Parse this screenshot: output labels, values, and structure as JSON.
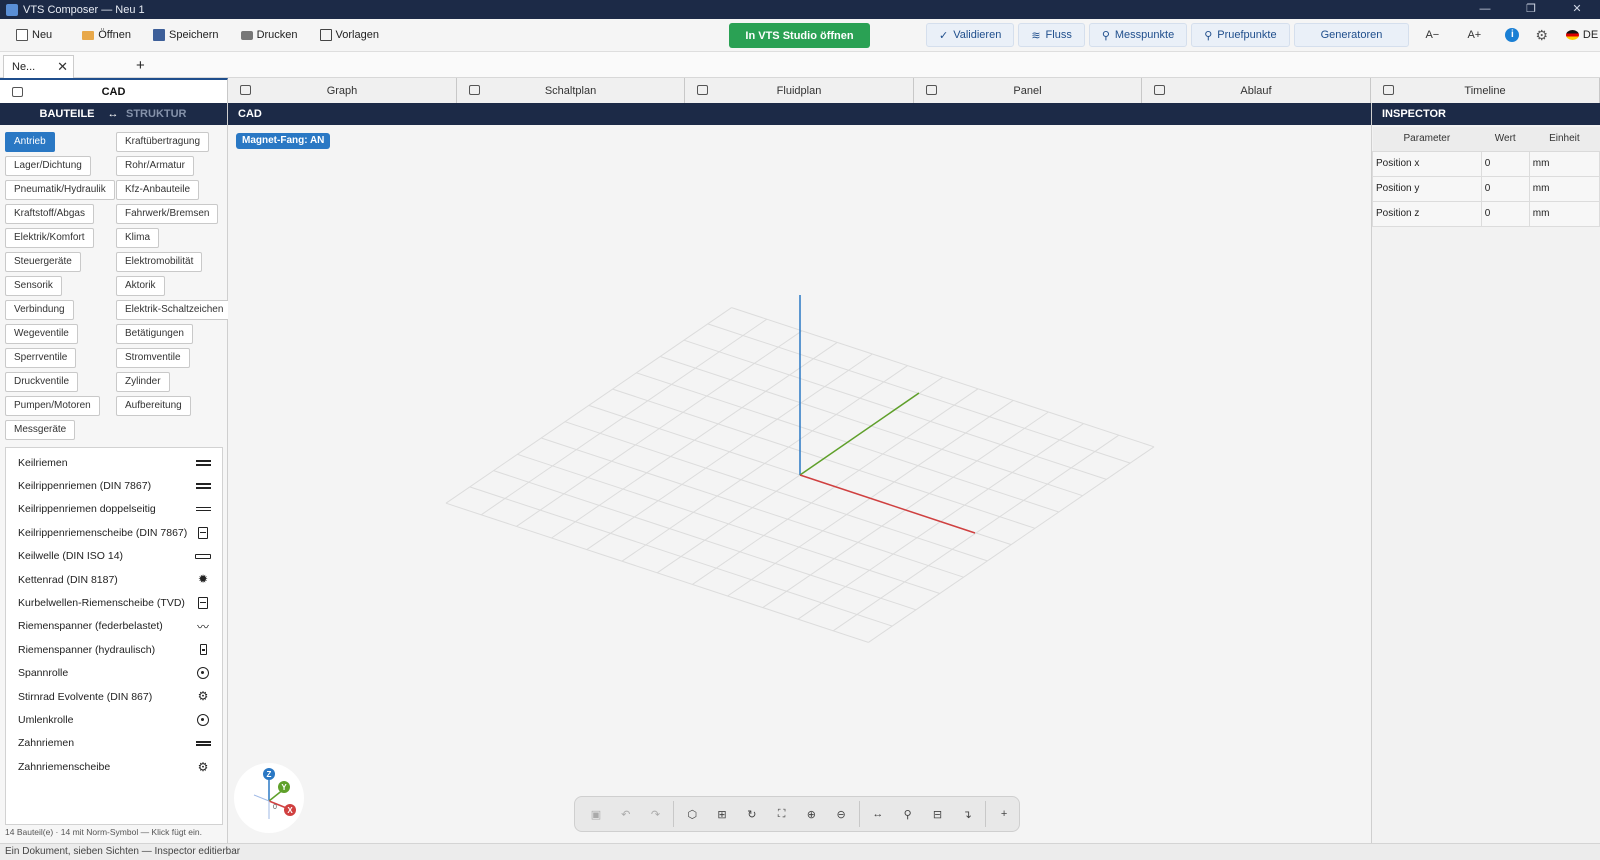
{
  "window": {
    "title": "VTS Composer — Neu 1",
    "controls": [
      "—",
      "❐",
      "✕"
    ]
  },
  "toolbar": {
    "new_label": "Neu",
    "open_label": "Öffnen",
    "save_label": "Speichern",
    "print_label": "Drucken",
    "templates_label": "Vorlagen",
    "studio_label": "In VTS Studio öffnen",
    "validate_label": "Validieren",
    "flow_label": "Fluss",
    "measure_points_label": "Messpunkte",
    "test_points_label": "Pruefpunkte",
    "generators_label": "Generatoren",
    "font_smaller": "A−",
    "font_larger": "A+",
    "language": "DE"
  },
  "doc_tabs": {
    "active_label": "Ne...",
    "close_glyph": "✕",
    "add_glyph": "+"
  },
  "view_tabs": [
    "CAD",
    "Graph",
    "Schaltplan",
    "Fluidplan",
    "Panel",
    "Ablauf",
    "Timeline"
  ],
  "left": {
    "tab_components": "BAUTEILE",
    "swap_glyph": "↔",
    "tab_structure": "STRUKTUR",
    "categories": [
      "Antrieb",
      "Kraftübertragung",
      "Lager/Dichtung",
      "Rohr/Armatur",
      "Pneumatik/Hydraulik",
      "Kfz-Anbauteile",
      "Kraftstoff/Abgas",
      "Fahrwerk/Bremsen",
      "Elektrik/Komfort",
      "Klima",
      "Steuergeräte",
      "Elektromobilität",
      "Sensorik",
      "Aktorik",
      "Verbindung",
      "Elektrik-Schaltzeichen",
      "Wegeventile",
      "Betätigungen",
      "Sperrventile",
      "Stromventile",
      "Druckventile",
      "Zylinder",
      "Pumpen/Motoren",
      "Aufbereitung",
      "Messgeräte"
    ],
    "components": [
      {
        "label": "Keilriemen",
        "icon": "double-line-icon"
      },
      {
        "label": "Keilrippenriemen (DIN 7867)",
        "icon": "double-line-icon"
      },
      {
        "label": "Keilrippenriemen doppelseitig",
        "icon": "double-line-icon"
      },
      {
        "label": "Keilrippenriemenscheibe (DIN 7867)",
        "icon": "pulley-box-icon"
      },
      {
        "label": "Keilwelle (DIN ISO 14)",
        "icon": "shaft-icon"
      },
      {
        "label": "Kettenrad (DIN 8187)",
        "icon": "sprocket-icon"
      },
      {
        "label": "Kurbelwellen-Riemenscheibe (TVD)",
        "icon": "pulley-box-icon"
      },
      {
        "label": "Riemenspanner (federbelastet)",
        "icon": "spring-icon"
      },
      {
        "label": "Riemenspanner (hydraulisch)",
        "icon": "hydraulic-icon"
      },
      {
        "label": "Spannrolle",
        "icon": "roller-icon"
      },
      {
        "label": "Stirnrad Evolvente (DIN 867)",
        "icon": "gear-icon"
      },
      {
        "label": "Umlenkrolle",
        "icon": "roller-icon"
      },
      {
        "label": "Zahnriemen",
        "icon": "belt-icon"
      },
      {
        "label": "Zahnriemenscheibe",
        "icon": "gear-icon"
      }
    ],
    "footer": "14 Bauteil(e) · 14 mit Norm-Symbol — Klick fügt ein."
  },
  "center": {
    "header": "CAD",
    "magnet_badge": "Magnet-Fang: AN",
    "gizmo": {
      "z": "Z",
      "y": "Y",
      "x": "X",
      "origin": "0"
    }
  },
  "inspector": {
    "header": "INSPECTOR",
    "columns": [
      "Parameter",
      "Wert",
      "Einheit"
    ],
    "rows": [
      {
        "param": "Position x",
        "value": "0",
        "unit": "mm"
      },
      {
        "param": "Position y",
        "value": "0",
        "unit": "mm"
      },
      {
        "param": "Position z",
        "value": "0",
        "unit": "mm"
      }
    ]
  },
  "status": {
    "text": "Ein Dokument, sieben Sichten — Inspector editierbar"
  },
  "colors": {
    "navy": "#1c2a47",
    "accent_blue": "#2a78c4",
    "green": "#2aa154",
    "axis_x": "#d04040",
    "axis_y": "#5fa02a",
    "axis_z": "#2a78c4"
  }
}
